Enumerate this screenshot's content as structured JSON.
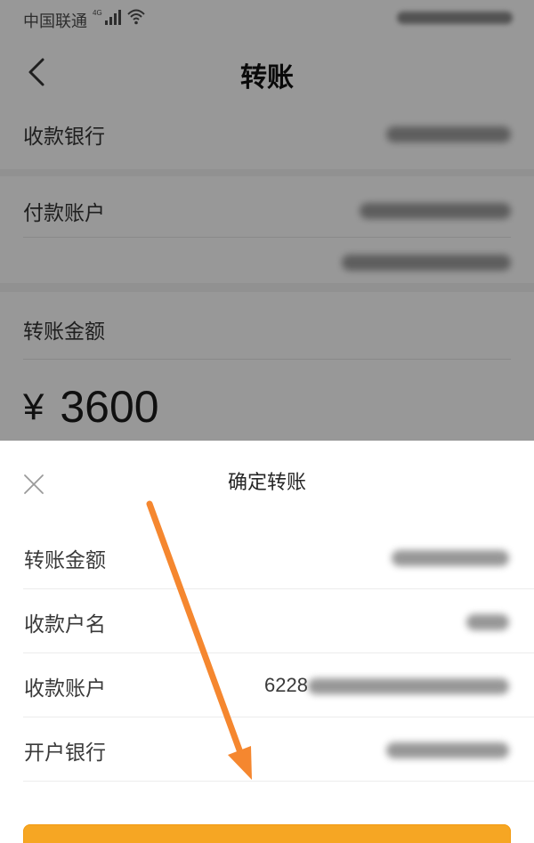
{
  "status_bar": {
    "carrier": "中国联通",
    "network_icon": "signal-4g-icon",
    "wifi_icon": "wifi-icon"
  },
  "navigation": {
    "title": "转账",
    "back_icon": "chevron-left-icon"
  },
  "background_form": {
    "rows": [
      {
        "label": "收款银行"
      },
      {
        "label": "付款账户"
      },
      {
        "label": "转账金额"
      }
    ],
    "amount": {
      "currency": "¥",
      "value": "3600"
    }
  },
  "sheet": {
    "title": "确定转账",
    "close_icon": "close-icon",
    "details": [
      {
        "label": "转账金额"
      },
      {
        "label": "收款户名"
      },
      {
        "label": "收款账户",
        "value_visible_prefix": "6228"
      },
      {
        "label": "开户银行"
      }
    ]
  },
  "annotation": {
    "arrow_color": "#f5872f"
  },
  "colors": {
    "confirm_button": "#f6a623"
  }
}
